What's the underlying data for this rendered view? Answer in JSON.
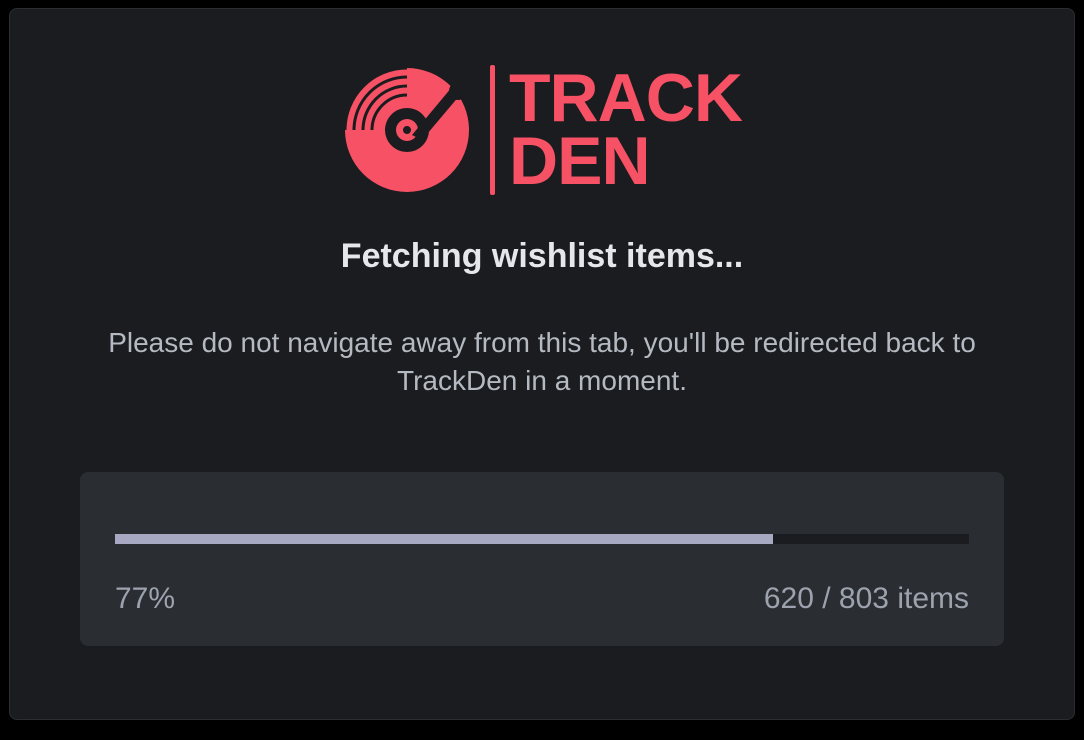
{
  "brand": {
    "line1": "TRACK",
    "line2": "DEN",
    "accent_color": "#f65164"
  },
  "heading": "Fetching wishlist items...",
  "subtext": "Please do not navigate away from this tab, you'll be redirected back to TrackDen in a moment.",
  "progress": {
    "percent": 77,
    "percent_label": "77%",
    "current": 620,
    "total": 803,
    "count_label": "620 / 803 items"
  }
}
